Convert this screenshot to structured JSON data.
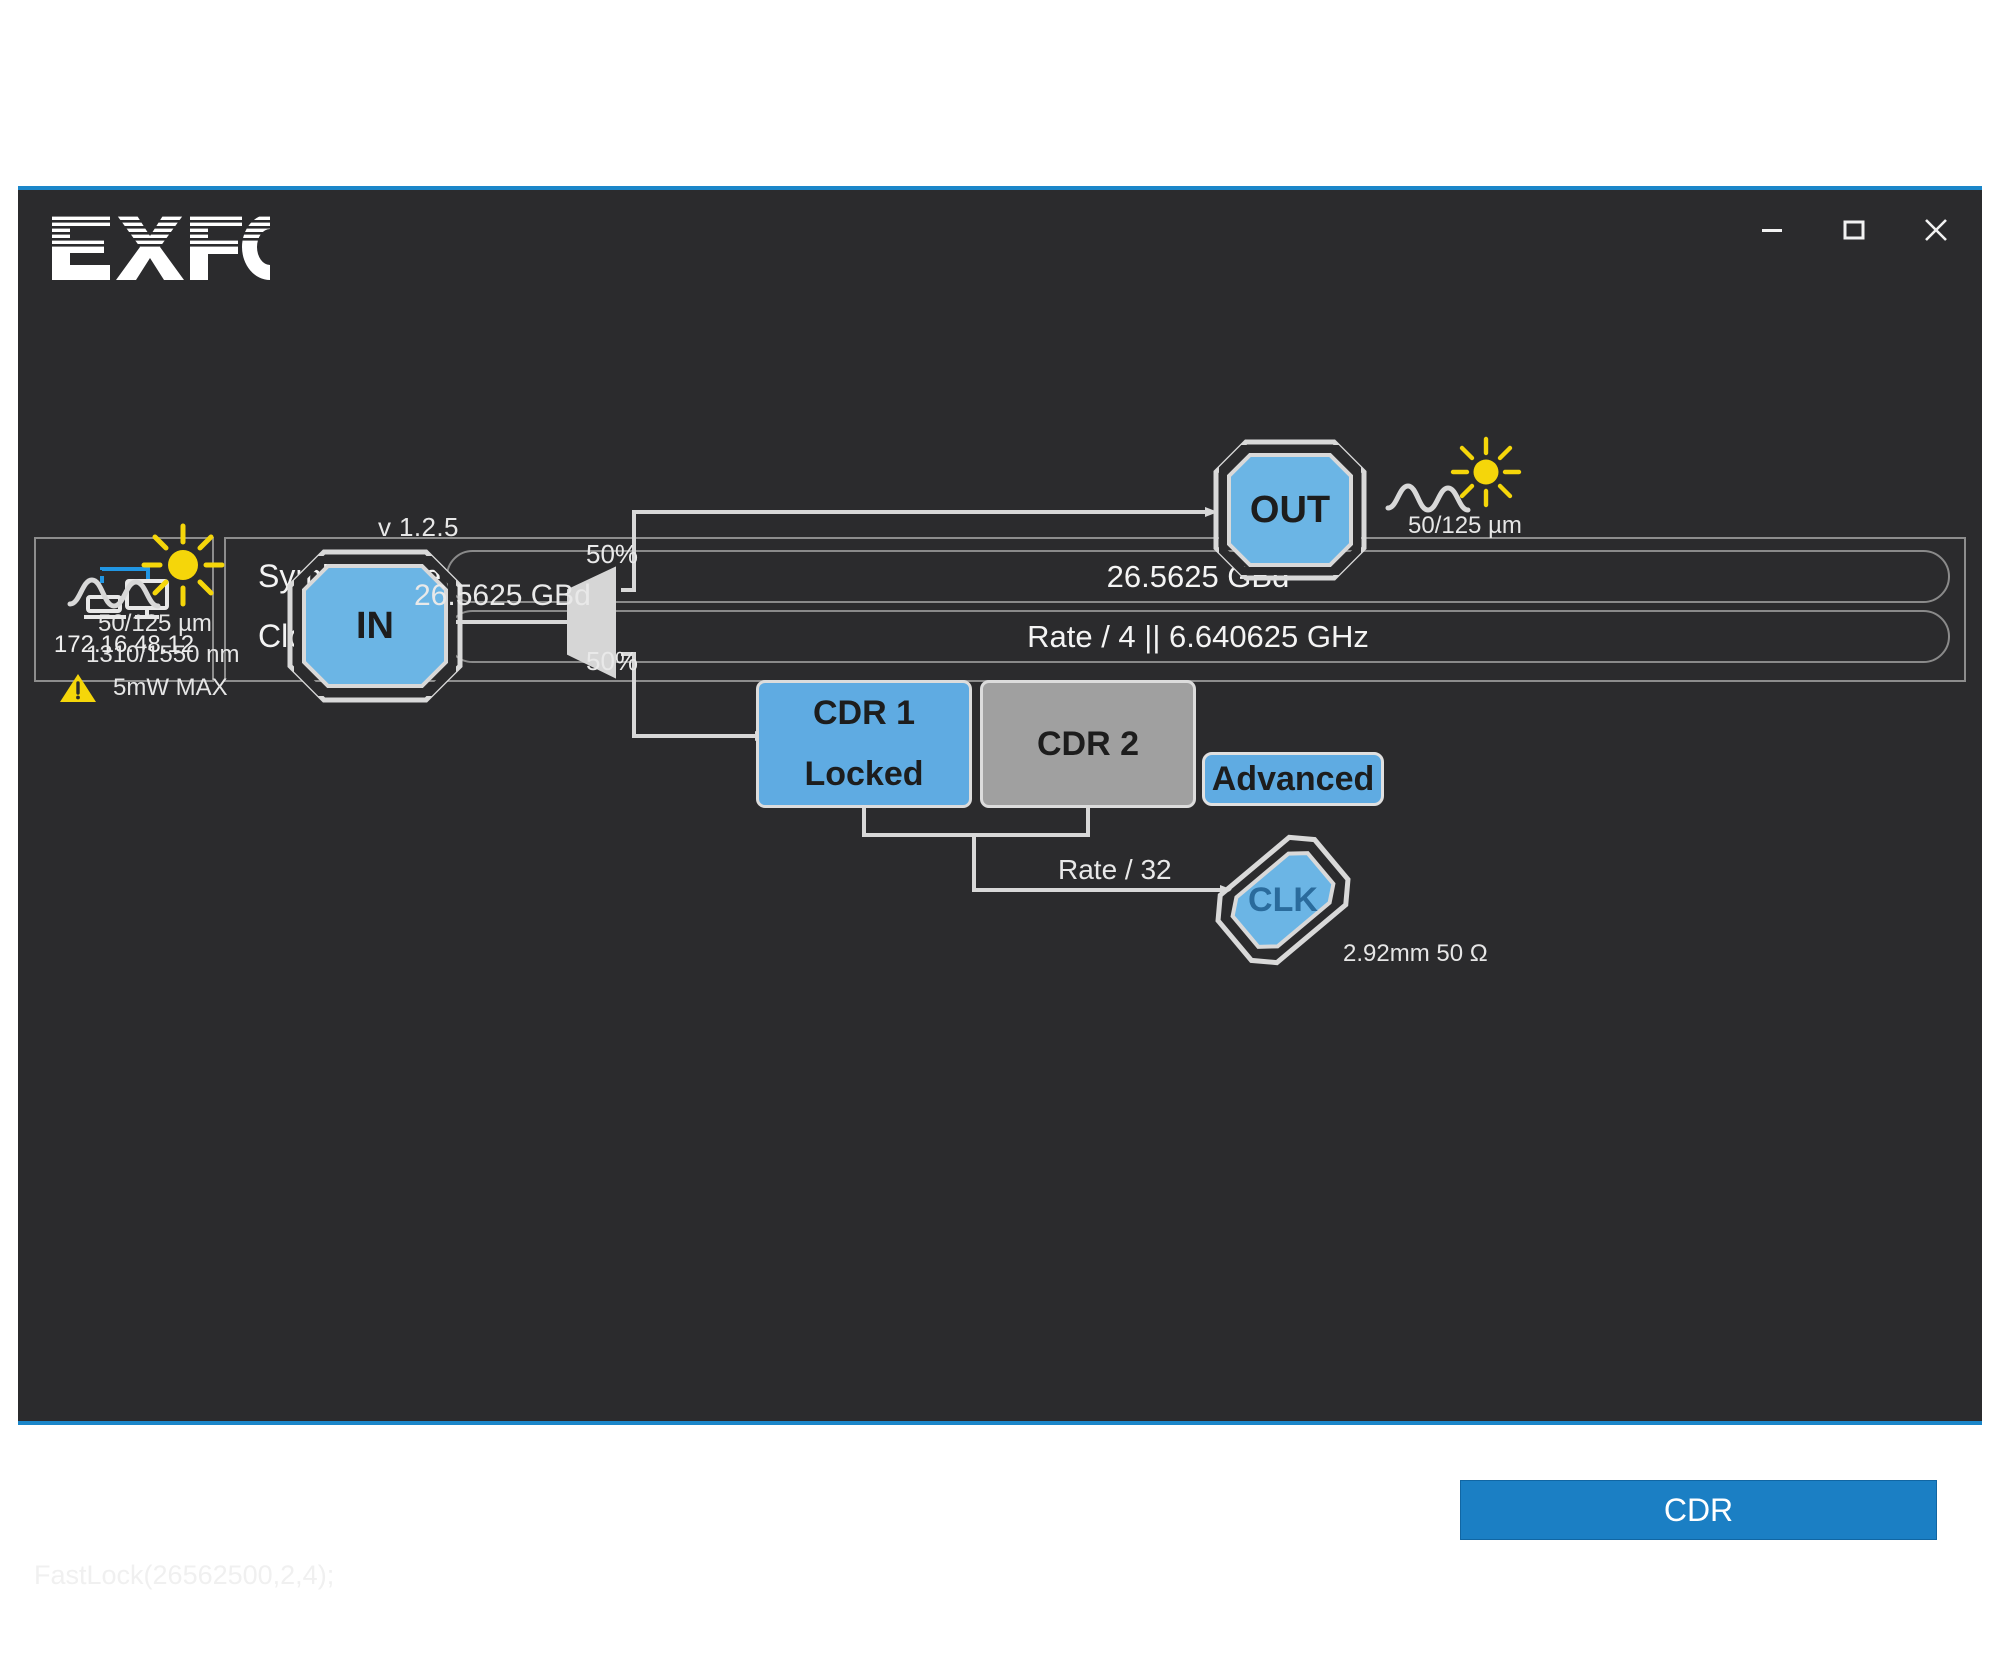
{
  "window": {
    "brand": "EXFO",
    "version": "v 1.2.5",
    "controls": {
      "minimize": "minimize-window",
      "maximize": "maximize-window",
      "close": "close-window"
    }
  },
  "device": {
    "icon": "network-devices-icon",
    "ip": "172.16.48.12"
  },
  "params": {
    "rows": [
      {
        "label": "Symbol Rate",
        "value": "26.5625 GBd"
      },
      {
        "label": "Clock Out",
        "value": "Rate / 4 || 6.640625 GHz"
      }
    ]
  },
  "diagram": {
    "input_port": {
      "label": "IN",
      "fiber": "50/125 µm",
      "wavelength": "1310/1550 nm",
      "power_warning": "5mW MAX",
      "icons": [
        "waveform-icon",
        "sun-icon",
        "warning-triangle-icon"
      ]
    },
    "link_rate": "26.5625 GBd",
    "splitter": {
      "top_ratio": "50%",
      "bottom_ratio": "50%"
    },
    "output_port": {
      "label": "OUT",
      "fiber": "50/125 µm",
      "icons": [
        "waveform-icon",
        "sun-icon"
      ]
    },
    "cdr1": {
      "title": "CDR 1",
      "status": "Locked",
      "color": "#5fabe2"
    },
    "cdr2": {
      "title": "CDR 2",
      "status": "",
      "color": "#a0a0a0"
    },
    "advanced_button": "Advanced",
    "clock_port": {
      "label": "CLK",
      "divider": "Rate / 32",
      "connector": "2.92mm 50 Ω"
    }
  },
  "footer": {
    "cdr_button": "CDR",
    "console": "FastLock(26562500,2,4);"
  },
  "colors": {
    "accent_blue": "#1b86c9",
    "port_blue": "#6bb5e5",
    "cdr_blue": "#5fabe2",
    "cdr_grey": "#a0a0a0",
    "background": "#2b2b2d",
    "sun_yellow": "#f5d60a"
  }
}
